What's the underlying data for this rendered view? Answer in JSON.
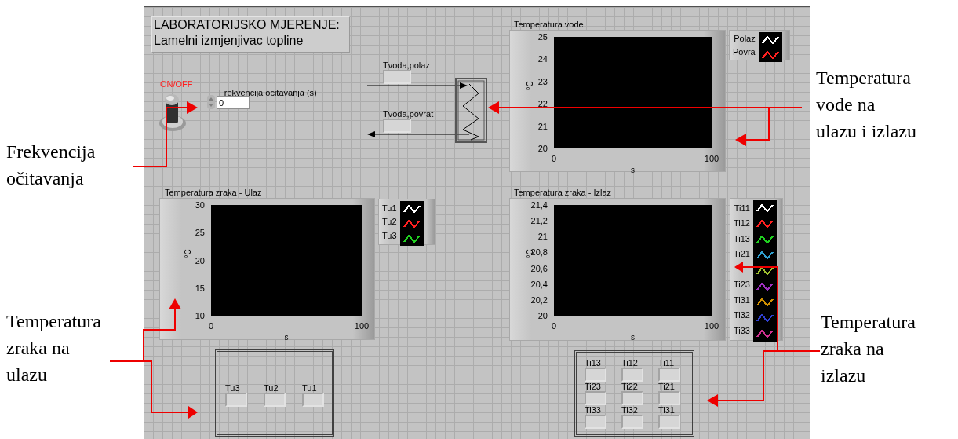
{
  "title_box": {
    "lines": [
      "LABORATORIJSKO MJERENJE:",
      "Lamelni izmjenjivac topline"
    ]
  },
  "power_switch": {
    "label": "ON/OFF",
    "on": false
  },
  "frequency_control": {
    "label": "Frekvencija ocitavanja (s)",
    "value": "0"
  },
  "water_indicators": [
    {
      "label": "Tvoda,polaz"
    },
    {
      "label": "Tvoda,povrat"
    }
  ],
  "charts": [
    {
      "title": "Temperatura vode",
      "x_label": "s",
      "y_label": "°C",
      "x_ticks": [
        "0",
        "100"
      ],
      "y_ticks": [
        "25",
        "24",
        "23",
        "22",
        "21",
        "20"
      ],
      "legend": [
        {
          "label": "Polaz",
          "color": "#ffffff"
        },
        {
          "label": "Povra",
          "color": "#ff2020"
        }
      ]
    },
    {
      "title": "Temperatura zraka - Ulaz",
      "x_label": "s",
      "y_label": "°C",
      "x_ticks": [
        "0",
        "100"
      ],
      "y_ticks": [
        "30",
        "25",
        "20",
        "15",
        "10"
      ],
      "legend": [
        {
          "label": "Tu1",
          "color": "#ffffff"
        },
        {
          "label": "Tu2",
          "color": "#ff2020"
        },
        {
          "label": "Tu3",
          "color": "#20d020"
        }
      ]
    },
    {
      "title": "Temperatura zraka - Izlaz",
      "x_label": "s",
      "y_label": "°C",
      "x_ticks": [
        "0",
        "100"
      ],
      "y_ticks": [
        "21,4",
        "21,2",
        "21",
        "20,8",
        "20,6",
        "20,4",
        "20,2",
        "20"
      ],
      "legend": [
        {
          "label": "Ti11",
          "color": "#ffffff"
        },
        {
          "label": "Ti12",
          "color": "#ff2020"
        },
        {
          "label": "Ti13",
          "color": "#20d020"
        },
        {
          "label": "Ti21",
          "color": "#30a0d0"
        },
        {
          "color": "#a0c030"
        },
        {
          "label": "Ti23",
          "color": "#a030c0"
        },
        {
          "label": "Ti31",
          "color": "#d09000"
        },
        {
          "label": "Ti32",
          "color": "#3040d0"
        },
        {
          "label": "Ti33",
          "color": "#d03090"
        }
      ]
    }
  ],
  "inlet_air_indicators": [
    {
      "label": "Tu3"
    },
    {
      "label": "Tu2"
    },
    {
      "label": "Tu1"
    }
  ],
  "outlet_air_indicators": [
    {
      "label": "Ti13"
    },
    {
      "label": "Ti12"
    },
    {
      "label": "Ti11"
    },
    {
      "label": "Ti23"
    },
    {
      "label": "Ti22"
    },
    {
      "label": "Ti21"
    },
    {
      "label": "Ti33"
    },
    {
      "label": "Ti32"
    },
    {
      "label": "Ti31"
    }
  ],
  "annotations": [
    {
      "lines": [
        "Frekvencija",
        "očitavanja"
      ]
    },
    {
      "lines": [
        "Temperatura",
        "zraka na",
        "ulazu"
      ]
    },
    {
      "lines": [
        "Temperatura",
        "vode na",
        "ulazu i izlazu"
      ]
    },
    {
      "lines": [
        "Temperatura",
        "zraka na",
        "izlazu"
      ]
    }
  ]
}
